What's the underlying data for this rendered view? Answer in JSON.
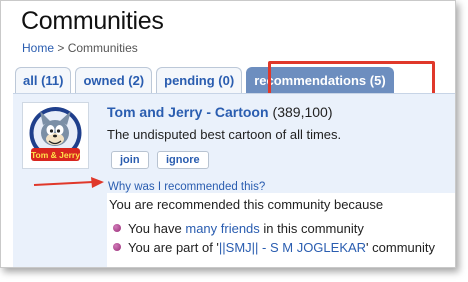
{
  "page": {
    "title": "Communities",
    "breadcrumb": {
      "home": "Home",
      "separator": ">",
      "current": "Communities"
    }
  },
  "tabs": [
    {
      "label": "all (11)"
    },
    {
      "label": "owned (2)"
    },
    {
      "label": "pending (0)"
    },
    {
      "label": "recommendations (5)",
      "active": true
    }
  ],
  "community": {
    "name": "Tom and Jerry - Cartoon",
    "members": "(389,100)",
    "description": "The undisputed best cartoon of all times.",
    "join_label": "join",
    "ignore_label": "ignore",
    "thumbnail_logo_text": "Tom & Jerry"
  },
  "recommendation": {
    "why_label": "Why was I recommended this?",
    "intro": "You are recommended this community because",
    "reason1": {
      "prefix": "You have ",
      "link": "many friends",
      "suffix": " in this community"
    },
    "reason2": {
      "prefix": "You are part of '",
      "link": "||SMJ|| - S M JOGLEKAR",
      "suffix": "' community"
    }
  },
  "colors": {
    "link": "#2a5db0",
    "active_tab": "#6d8ebf",
    "annotation": "#e0382a",
    "panel": "#eaf1fb",
    "bullet": "#b0408e"
  },
  "icons": {
    "annotation_arrow": "arrow-right-icon",
    "community_thumbnail": "tom-and-jerry-logo",
    "list_bullet": "bullet-icon"
  }
}
